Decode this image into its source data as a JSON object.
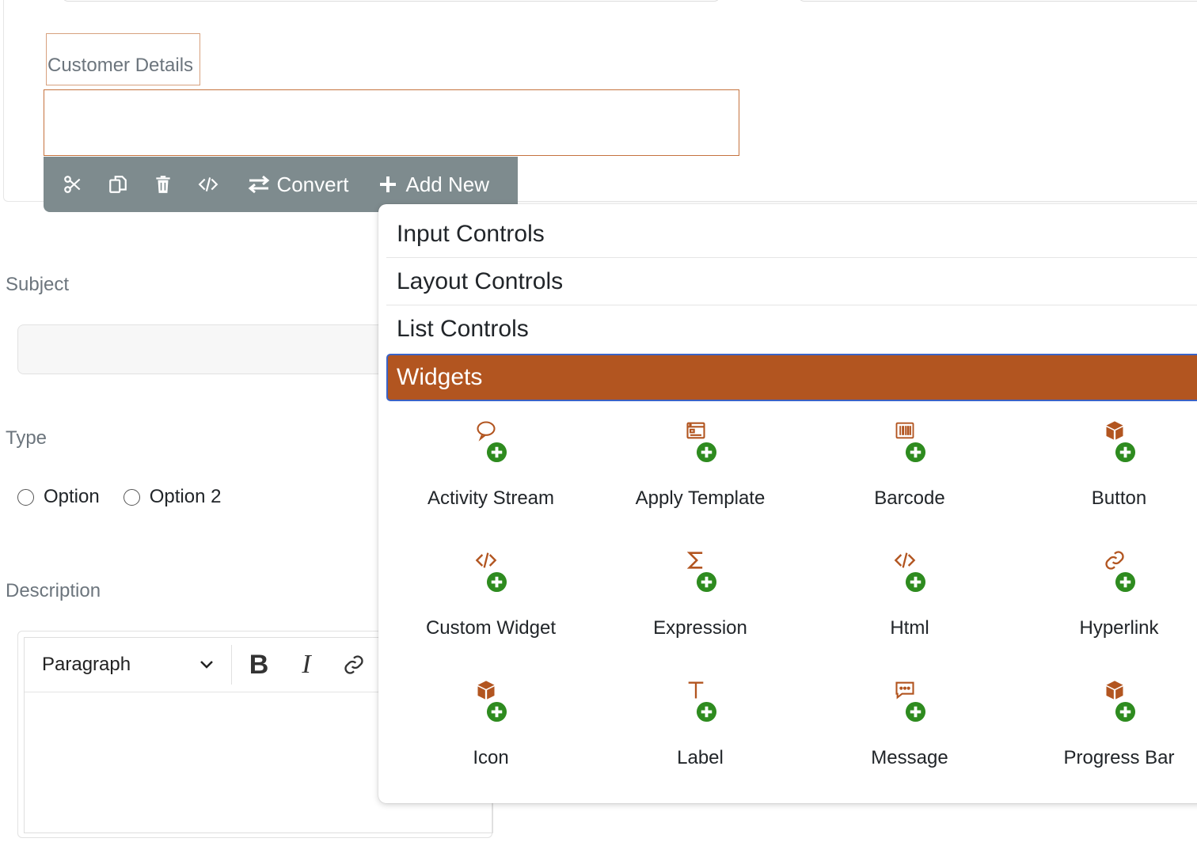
{
  "section": {
    "title": "Customer Details"
  },
  "toolbar": {
    "convert_label": "Convert",
    "add_new_label": "Add New"
  },
  "form": {
    "subject_label": "Subject",
    "type_label": "Type",
    "description_label": "Description",
    "options": [
      "Option",
      "Option 2"
    ]
  },
  "editor": {
    "paragraph_label": "Paragraph"
  },
  "panel": {
    "categories": [
      "Input Controls",
      "Layout Controls",
      "List Controls",
      "Widgets"
    ],
    "active_category": "Widgets",
    "widgets": [
      {
        "label": "Activity Stream",
        "icon": "speech-bubble-icon"
      },
      {
        "label": "Apply Template",
        "icon": "template-window-icon"
      },
      {
        "label": "Barcode",
        "icon": "barcode-icon"
      },
      {
        "label": "Button",
        "icon": "cube-icon"
      },
      {
        "label": "Custom Widget",
        "icon": "code-icon"
      },
      {
        "label": "Expression",
        "icon": "sigma-icon"
      },
      {
        "label": "Html",
        "icon": "code-icon"
      },
      {
        "label": "Hyperlink",
        "icon": "link-icon"
      },
      {
        "label": "Icon",
        "icon": "cube-icon"
      },
      {
        "label": "Label",
        "icon": "text-t-icon"
      },
      {
        "label": "Message",
        "icon": "message-dots-icon"
      },
      {
        "label": "Progress Bar",
        "icon": "cube-icon"
      }
    ]
  },
  "colors": {
    "accent": "#b25520",
    "toolbar_bg": "#7e8b8e",
    "plus_green": "#2e8b1f",
    "focus_border": "#3a63c7"
  }
}
